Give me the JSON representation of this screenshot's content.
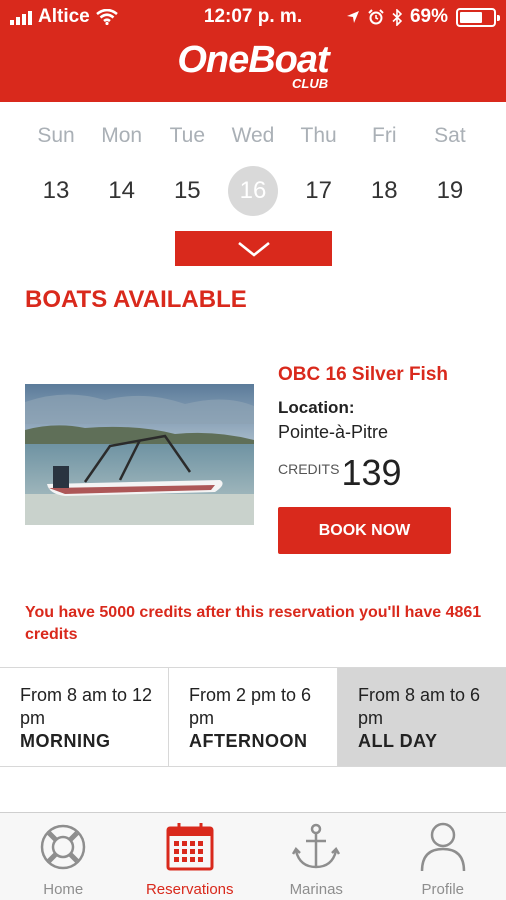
{
  "status_bar": {
    "carrier": "Altice",
    "time": "12:07 p. m.",
    "battery": "69%",
    "battery_level": 0.69
  },
  "header": {
    "logo_main": "OneBoat",
    "logo_sub": "CLUB"
  },
  "calendar": {
    "day_names": [
      "Sun",
      "Mon",
      "Tue",
      "Wed",
      "Thu",
      "Fri",
      "Sat"
    ],
    "dates": [
      "13",
      "14",
      "15",
      "16",
      "17",
      "18",
      "19"
    ],
    "selected_date": "16"
  },
  "section_title": "BOATS AVAILABLE",
  "boat": {
    "name": "OBC 16 Silver Fish",
    "location_label": "Location:",
    "location": "Pointe-à-Pitre",
    "credits_label": "CREDITS",
    "credits": "139",
    "book_label": "BOOK NOW"
  },
  "notice": "You have 5000 credits after this reservation you'll have 4861 credits",
  "slots": [
    {
      "time": "From 8 am to 12 pm",
      "name": "MORNING",
      "active": false
    },
    {
      "time": "From 2 pm to 6 pm",
      "name": "AFTERNOON",
      "active": false
    },
    {
      "time": "From 8 am to 6 pm",
      "name": "ALL DAY",
      "active": true
    }
  ],
  "tabs": [
    {
      "label": "Home",
      "icon": "lifebuoy-icon",
      "active": false
    },
    {
      "label": "Reservations",
      "icon": "calendar-icon",
      "active": true
    },
    {
      "label": "Marinas",
      "icon": "anchor-icon",
      "active": false
    },
    {
      "label": "Profile",
      "icon": "person-icon",
      "active": false
    }
  ],
  "colors": {
    "brand_red": "#d9291c",
    "selected_slot": "#d6d6d6",
    "inactive_tab": "#8e8e8e"
  }
}
